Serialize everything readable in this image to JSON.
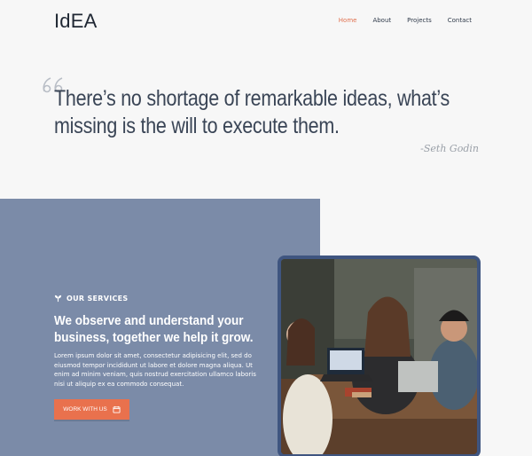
{
  "header": {
    "logo": "IdEA",
    "nav": [
      {
        "label": "Home",
        "active": true
      },
      {
        "label": "About",
        "active": false
      },
      {
        "label": "Projects",
        "active": false
      },
      {
        "label": "Contact",
        "active": false
      }
    ]
  },
  "quote": {
    "text": "There’s no shortage of remarkable ideas, what’s missing is the will to execute them.",
    "author": "-Seth Godin"
  },
  "services": {
    "label": "OUR SERVICES",
    "title": "We observe and understand your business, together we help it grow.",
    "body": "Lorem ipsum dolor sit amet, consectetur adipisicing elit, sed do eiusmod tempor incididunt ut labore et dolore magna aliqua. Ut enim ad minim veniam, quis nostrud exercitation ullamco laboris nisi ut aliquip ex ea commodo consequat.",
    "button_label": "WORK WITH US"
  },
  "colors": {
    "accent": "#e9714d",
    "panel": "#7b8ba8",
    "frame": "#3f5580"
  },
  "icons": {
    "quote": "quote-mark-icon",
    "services": "leaf-sprout-icon",
    "button": "calendar-icon"
  }
}
